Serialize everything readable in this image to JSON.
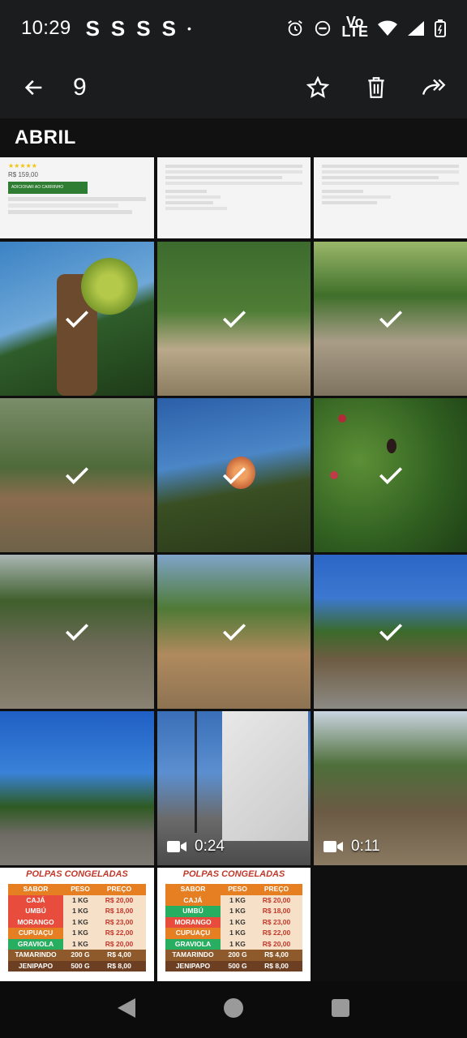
{
  "status": {
    "time": "10:29",
    "notifications": [
      "S",
      "S",
      "S",
      "S"
    ],
    "dot": "•",
    "lte_top": "Vo",
    "lte_bottom": "LTE"
  },
  "toolbar": {
    "selected_count": "9"
  },
  "section": {
    "month": "ABRIL"
  },
  "videos": [
    {
      "duration": "0:24"
    },
    {
      "duration": "0:11"
    }
  ],
  "doc_tile": {
    "price": "R$ 159,00",
    "button": "ADICIONAR AO CARRINHO"
  },
  "poster": {
    "title": "POLPAS CONGELADAS",
    "headers": [
      "SABOR",
      "PESO",
      "PREÇO"
    ],
    "rows": [
      [
        "CAJÁ",
        "1 KG",
        "R$ 20,00"
      ],
      [
        "UMBÚ",
        "1 KG",
        "R$ 18,00"
      ],
      [
        "MORANGO",
        "1 KG",
        "R$ 23,00"
      ],
      [
        "CUPUAÇU",
        "1 KG",
        "R$ 22,00"
      ],
      [
        "GRAVIOLA",
        "1 KG",
        "R$ 20,00"
      ],
      [
        "TAMARINDO",
        "200 G",
        "R$ 4,00"
      ],
      [
        "JENIPAPO",
        "500 G",
        "R$ 8,00"
      ]
    ]
  },
  "colors": {
    "bar": "#1b1c1e",
    "background": "#0f0f10",
    "poster_header": "#d35400",
    "poster_red": "#c0392b"
  }
}
